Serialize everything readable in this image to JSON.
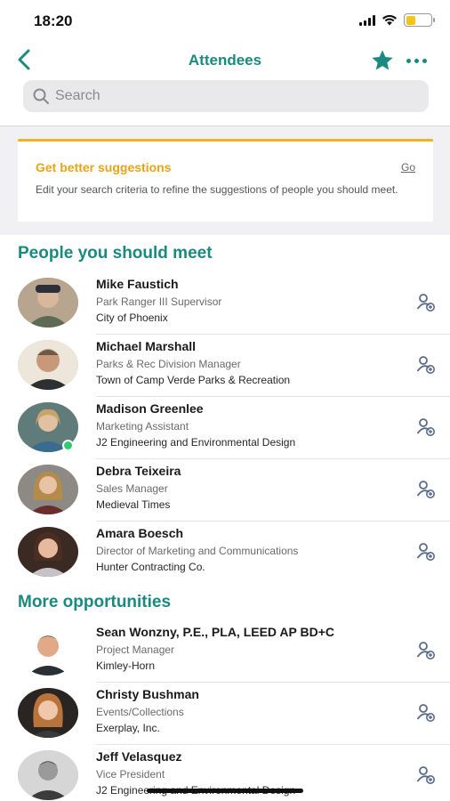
{
  "status_bar": {
    "time": "18:20"
  },
  "nav": {
    "title": "Attendees"
  },
  "search": {
    "placeholder": "Search"
  },
  "suggestion_card": {
    "title": "Get better suggestions",
    "action": "Go",
    "description": "Edit your search criteria to refine the suggestions of people you should meet."
  },
  "sections": [
    {
      "title": "People you should meet"
    },
    {
      "title": "More opportunities"
    }
  ],
  "people_should_meet": [
    {
      "name": "Mike Faustich",
      "role": "Park Ranger III Supervisor",
      "org": "City of Phoenix"
    },
    {
      "name": "Michael Marshall",
      "role": "Parks & Rec Division Manager",
      "org": "Town of Camp Verde Parks & Recreation"
    },
    {
      "name": "Madison Greenlee",
      "role": "Marketing Assistant",
      "org": "J2 Engineering and Environmental Design"
    },
    {
      "name": "Debra Teixeira",
      "role": "Sales Manager",
      "org": "Medieval Times"
    },
    {
      "name": "Amara Boesch",
      "role": "Director of Marketing and Communications",
      "org": "Hunter Contracting Co."
    }
  ],
  "more_opportunities": [
    {
      "name": "Sean Wonzny, P.E., PLA, LEED AP BD+C",
      "role": "Project Manager",
      "org": "Kimley-Horn"
    },
    {
      "name": "Christy Bushman",
      "role": "Events/Collections",
      "org": "Exerplay, Inc."
    },
    {
      "name": "Jeff Velasquez",
      "role": "Vice President",
      "org": "J2 Engineering and Environmental Design"
    }
  ],
  "colors": {
    "accent": "#1a8a80",
    "warning": "#f3b21f",
    "online": "#2ecc71"
  }
}
